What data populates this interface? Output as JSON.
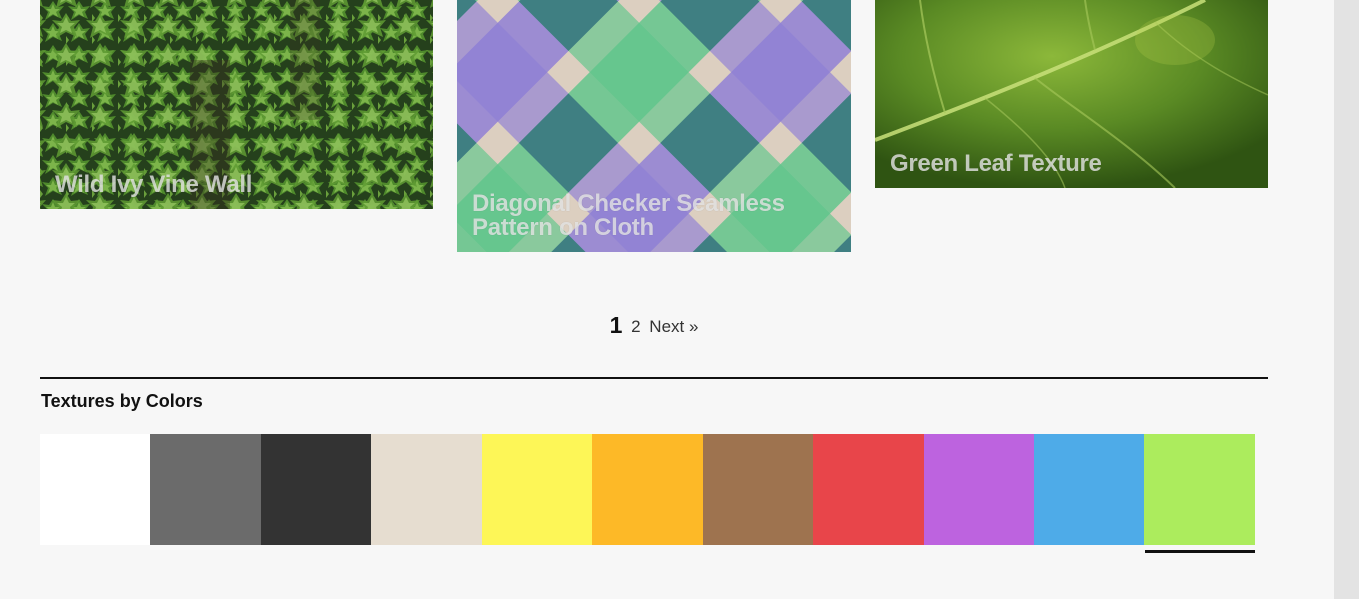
{
  "cards": [
    {
      "title": "Wild Ivy Vine Wall"
    },
    {
      "title": "Diagonal Checker Seamless Pattern on Cloth"
    },
    {
      "title": "Green Leaf Texture"
    }
  ],
  "pagination": {
    "current": "1",
    "page2": "2",
    "next": "Next »"
  },
  "colors_section": {
    "title": "Textures by Colors",
    "swatches": [
      {
        "name": "white",
        "color": "#ffffff"
      },
      {
        "name": "gray",
        "color": "#6b6b6b"
      },
      {
        "name": "black",
        "color": "#333333"
      },
      {
        "name": "beige",
        "color": "#e6ddd0"
      },
      {
        "name": "yellow",
        "color": "#fdf657"
      },
      {
        "name": "orange",
        "color": "#fdb927"
      },
      {
        "name": "brown",
        "color": "#9e734f"
      },
      {
        "name": "red",
        "color": "#e8454a"
      },
      {
        "name": "purple",
        "color": "#bd63df"
      },
      {
        "name": "blue",
        "color": "#4eabe8"
      },
      {
        "name": "green",
        "color": "#acec5d"
      }
    ],
    "active": "green"
  }
}
